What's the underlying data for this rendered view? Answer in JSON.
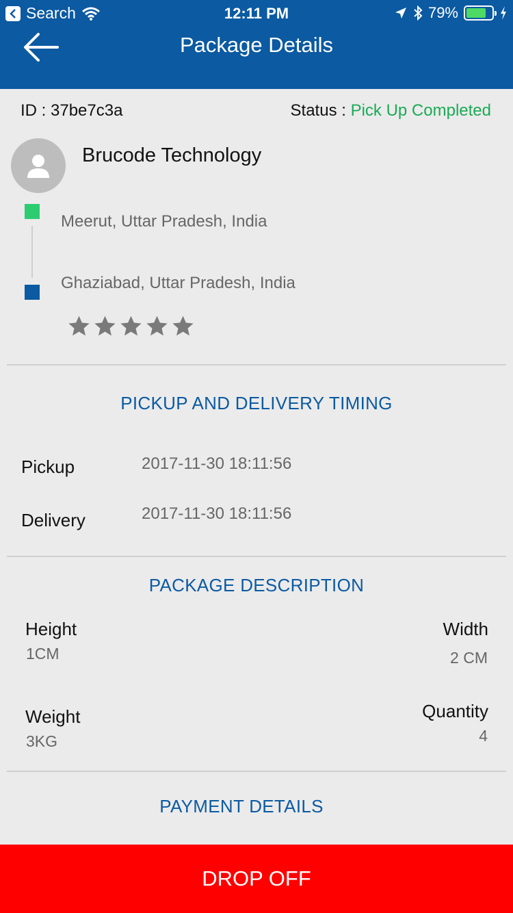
{
  "status_bar": {
    "back_app": "Search",
    "time": "12:11 PM",
    "battery": "79%",
    "battery_level": 0.79
  },
  "header": {
    "title": "Package Details",
    "back_icon": "back-arrow-icon"
  },
  "package": {
    "id_label": "ID : ",
    "id": "37be7c3a",
    "status_label": "Status : ",
    "status": "Pick Up Completed",
    "status_color": "#1aaa55"
  },
  "sender": {
    "name": "Brucode Technology",
    "avatar_icon": "person-icon",
    "pickup_address": "Meerut, Uttar Pradesh, India",
    "drop_address": "Ghaziabad, Uttar Pradesh, India",
    "rating": 0,
    "rating_max": 5
  },
  "timing": {
    "title": "PICKUP AND DELIVERY TIMING",
    "pickup_label": "Pickup",
    "pickup_value": "2017-11-30 18:11:56",
    "delivery_label": "Delivery",
    "delivery_value": "2017-11-30 18:11:56"
  },
  "description": {
    "title": "PACKAGE DESCRIPTION",
    "height_label": "Height",
    "height_value": "1CM",
    "width_label": "Width",
    "width_value": "2 CM",
    "weight_label": "Weight",
    "weight_value": "3KG",
    "quantity_label": "Quantity",
    "quantity_value": "4"
  },
  "payment": {
    "title": "PAYMENT DETAILS"
  },
  "actions": {
    "drop_off": "DROP OFF"
  },
  "colors": {
    "primary": "#0b5aa2",
    "accent_green": "#2ecc71",
    "action_red": "#ff0000",
    "background": "#ebebeb"
  }
}
